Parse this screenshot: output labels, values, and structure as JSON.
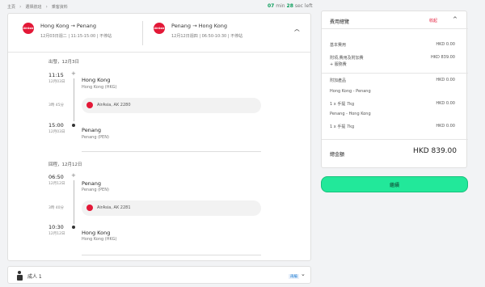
{
  "breadcrumbs": [
    "主頁",
    "選擇航班",
    "乘客資料"
  ],
  "timer": {
    "minutes": "07",
    "min_label": "min",
    "seconds": "28",
    "sec_label": "sec left"
  },
  "legs": [
    {
      "logo": "AirAsia",
      "route": "Hong Kong → Penang",
      "meta": "12月03日週二 | 11:15-15:00 | 不停站"
    },
    {
      "logo": "AirAsia",
      "route": "Penang → Hong Kong",
      "meta": "12月12日週四 | 06:50-10:30 | 不停站"
    }
  ],
  "outbound": {
    "title": "出發，12月3日",
    "dep_time": "11:15",
    "dep_date": "12月03日",
    "dep_city": "Hong Kong",
    "dep_airport": "Hong Kong (HKG)",
    "duration": "3時 45分",
    "flight": "AirAsia, AK 2280",
    "arr_time": "15:00",
    "arr_date": "12月03日",
    "arr_city": "Penang",
    "arr_airport": "Penang (PEN)"
  },
  "return": {
    "title": "回程，12月12日",
    "dep_time": "06:50",
    "dep_date": "12月12日",
    "dep_city": "Penang",
    "dep_airport": "Penang (PEN)",
    "duration": "3時 40分",
    "flight": "AirAsia, AK 2281",
    "arr_time": "10:30",
    "arr_date": "12月12日",
    "arr_city": "Hong Kong",
    "arr_airport": "Hong Kong (HKG)"
  },
  "passenger": {
    "label": "成人 1",
    "edit": "再編"
  },
  "summary": {
    "title": "費用總覽",
    "toggle": "收起",
    "base_label": "基本費用",
    "base_amount": "HKD 0.00",
    "tax_label": "附項,費用及附加費\n+ 服務費",
    "tax_amount": "HKD 839.00",
    "addons_label": "附加產品",
    "addons_amount": "HKD 0.00",
    "addon_route1": "Hong Kong - Penang",
    "addon_item1": "1 x 手提 7kg",
    "addon_item1_amount": "HKD 0.00",
    "addon_route2": "Penang - Hong Kong",
    "addon_item2": "1 x 手提 7kg",
    "addon_item2_amount": "HKD 0.00",
    "total_label": "總金額",
    "total_amount": "HKD 839.00"
  },
  "continue_label": "繼續",
  "colors": {
    "brand": "#e31837",
    "accent": "#22e89a",
    "timer": "#0a9d5a"
  }
}
